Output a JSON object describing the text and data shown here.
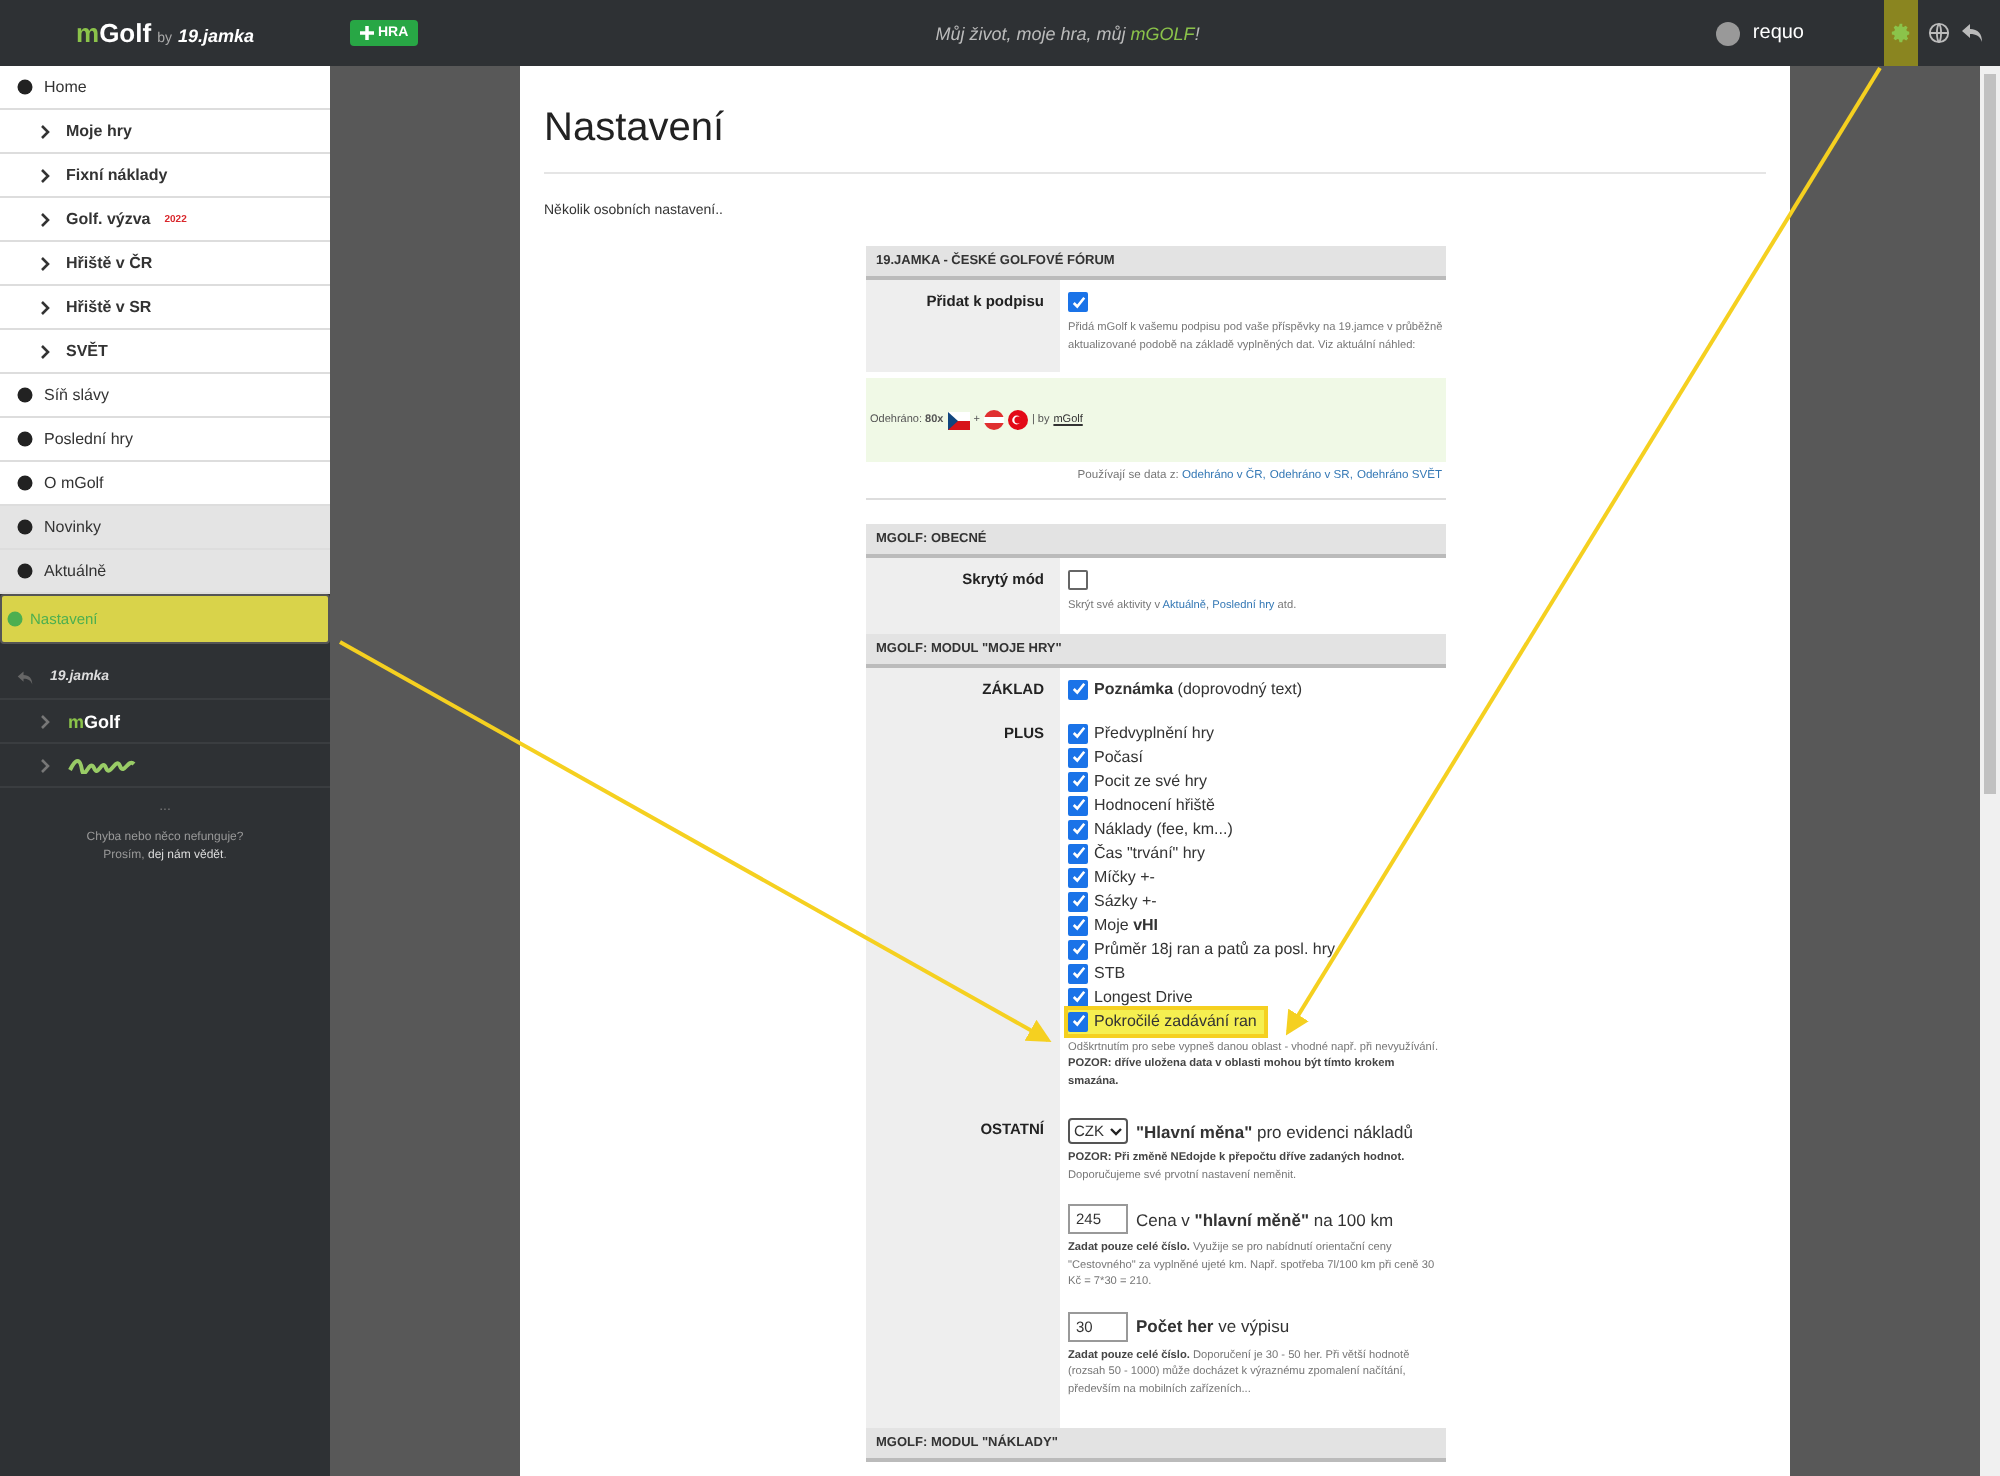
{
  "topbar": {
    "logo_m": "m",
    "logo_rest": "Golf",
    "logo_by": "by",
    "partner_logo": "19.jamka",
    "add_button": "HRA",
    "motto": "Můj život, moje hra, můj **mGOLF**!",
    "user": "requo",
    "settings_highlighted": true
  },
  "sidebar": {
    "items": [
      {
        "label": "Home",
        "kind": "main",
        "selected": false,
        "highlighted": false
      },
      {
        "label": "Moje hry",
        "kind": "sub",
        "selected": false,
        "highlighted": false
      },
      {
        "label": "Fixní náklady",
        "kind": "sub",
        "selected": false,
        "highlighted": false
      },
      {
        "label": "Golf. výzva",
        "badge": "2022",
        "kind": "sub",
        "selected": false,
        "highlighted": false
      },
      {
        "label": "Hřiště v ČR",
        "kind": "sub",
        "selected": false,
        "highlighted": false
      },
      {
        "label": "Hřiště v SR",
        "kind": "sub",
        "selected": false,
        "highlighted": false
      },
      {
        "label": "SVĚT",
        "kind": "sub",
        "selected": false,
        "highlighted": false
      },
      {
        "label": "Síň slávy",
        "kind": "main",
        "selected": false,
        "highlighted": false
      },
      {
        "label": "Poslední hry",
        "kind": "main",
        "selected": false,
        "highlighted": false
      },
      {
        "label": "O mGolf",
        "kind": "main",
        "selected": false,
        "highlighted": false
      },
      {
        "label": "Novinky",
        "kind": "news",
        "selected": false,
        "highlighted": false
      },
      {
        "label": "Aktuálně",
        "kind": "news",
        "selected": false,
        "highlighted": false
      },
      {
        "label": "Nastavení",
        "kind": "main",
        "selected": true,
        "highlighted": true
      }
    ],
    "partners": [
      {
        "kind": "jamka",
        "label": "19.jamka"
      },
      {
        "kind": "mgolf",
        "label_m": "m",
        "label_rest": "Golf"
      },
      {
        "kind": "igolf"
      }
    ],
    "dots": "...",
    "footer_line": "Chyba nebo něco nefunguje?",
    "footer_parts": [
      {
        "text": "Prosím, "
      },
      {
        "link": "dej nám vědět"
      },
      {
        "text": "."
      }
    ]
  },
  "page": {
    "title": "Nastavení",
    "intro": "Několik osobních nastavení..",
    "sections": [
      {
        "heading": "19.JAMKA - ČESKÉ GOLFOVÉ FÓRUM",
        "rows": [
          {
            "kind": "checkbox",
            "label": "Přidat k podpisu",
            "options": [
              {
                "checked": true,
                "highlighted": false
              }
            ],
            "help": "Přidá mGolf k vašemu podpisu pod vaše příspěvky na 19.jamce v průběžně aktualizované podobě na základě vyplněných dat. Viz aktuální náhled:"
          }
        ],
        "preview": {
          "text": "Odehráno: **80x**",
          "plus": "+",
          "by": "| by",
          "link": "mGolf"
        },
        "sources": [
          {
            "text": "Používají se data z: "
          },
          {
            "link": "Odehráno v ČR,"
          },
          {
            "link": "Odehráno v SR,"
          },
          {
            "link": "Odehráno SVĚT"
          }
        ]
      },
      {
        "heading": "MGOLF: OBECNÉ",
        "rows": [
          {
            "kind": "checkbox",
            "label": "Skrytý mód",
            "options": [
              {
                "checked": false,
                "highlighted": false
              }
            ],
            "help_parts": [
              {
                "text": "Skrýt své aktivity v "
              },
              {
                "link": "Aktuálně"
              },
              {
                "text": ", "
              },
              {
                "link": "Poslední hry"
              },
              {
                "text": " atd."
              }
            ]
          }
        ]
      },
      {
        "heading": "MGOLF: MODUL \"MOJE HRY\"",
        "rows": [
          {
            "kind": "checkbox",
            "label": "ZÁKLAD",
            "options": [
              {
                "text": "**Poznámka** (doprovodný text)",
                "checked": true,
                "highlighted": false
              }
            ]
          },
          {
            "kind": "checkbox",
            "label": "PLUS",
            "options": [
              {
                "text": "Předvyplnění hry",
                "checked": true,
                "highlighted": false
              },
              {
                "text": "Počasí",
                "checked": true,
                "highlighted": false
              },
              {
                "text": "Pocit ze své hry",
                "checked": true,
                "highlighted": false
              },
              {
                "text": "Hodnocení hřiště",
                "checked": true,
                "highlighted": false
              },
              {
                "text": "Náklady (fee, km...)",
                "checked": true,
                "highlighted": false
              },
              {
                "text": "Čas \"trvání\" hry",
                "checked": true,
                "highlighted": false
              },
              {
                "text": "Míčky +-",
                "checked": true,
                "highlighted": false
              },
              {
                "text": "Sázky +-",
                "checked": true,
                "highlighted": false
              },
              {
                "text": "Moje **vHI**",
                "checked": true,
                "highlighted": false
              },
              {
                "text": "Průměr 18j ran a patů za posl. hry",
                "checked": true,
                "highlighted": false
              },
              {
                "text": "STB",
                "checked": true,
                "highlighted": false
              },
              {
                "text": "Longest Drive",
                "checked": true,
                "highlighted": false
              },
              {
                "text": "Pokročilé zadávání ran",
                "checked": true,
                "highlighted": true
              }
            ],
            "help": "Odškrtnutím pro sebe vypneš danou oblast - vhodné např. při nevyužívání. **POZOR: dříve uložena data v oblasti mohou být tímto krokem smazána.**"
          },
          {
            "kind": "fields",
            "label": "OSTATNÍ",
            "fields": [
              {
                "kind": "select",
                "value": "CZK",
                "label": "**\"Hlavní měna\"** pro evidenci nákladů",
                "help": "**POZOR: Při změně NEdojde k přepočtu dříve zadaných hodnot.** Doporučujeme své prvotní nastavení neměnit."
              },
              {
                "kind": "input",
                "value": "245",
                "label": "Cena v **\"hlavní měně\"** na 100 km",
                "help": "**Zadat pouze celé číslo.** Využije se pro nabídnutí orientační ceny \"Cestovného\" za vyplněné ujeté km. Např. spotřeba 7l/100 km při ceně 30 Kč = 7*30 = 210."
              },
              {
                "kind": "input",
                "value": "30",
                "label": "**Počet her** ve výpisu",
                "help": "**Zadat pouze celé číslo.** Doporučení je 30 - 50 her. Při větší hodnotě (rozsah 50 - 1000) může docházet k výraznému zpomalení načítání, především na mobilních zařízeních..."
              }
            ]
          }
        ]
      },
      {
        "heading": "MGOLF: MODUL \"NÁKLADY\""
      }
    ]
  }
}
